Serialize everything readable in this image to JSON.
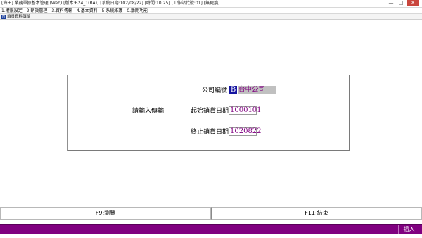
{
  "window": {
    "title": "[海田] 業務單據基本管理 (Web) [版本:B24_1(BA)] [系統日期:102/08/22] [時間:10:25] [工作站代號:01] [無更換]",
    "controls": {
      "minimize": "—",
      "maximize": "□",
      "close": "✕"
    }
  },
  "menu": {
    "items": [
      "1.權限設定",
      "2.銷貨管理",
      "3.資料傳輸",
      "4.基本資料",
      "5.系統維護",
      "0.離開功能"
    ]
  },
  "subwindow": {
    "icon": "app-icon",
    "title": "銷貨資料傳輸"
  },
  "form": {
    "prompt": "請輸入傳輸",
    "company_code_label": "公司編號",
    "company_code_value": "B",
    "company_name_value": "台中公司",
    "start_date_label": "起始銷貨日期",
    "start_date_value": "1000101",
    "end_date_label": "終止銷貨日期",
    "end_date_value": "1020822"
  },
  "function_keys": [
    {
      "label": "F9:瀏覽"
    },
    {
      "label": "F11:結束"
    }
  ],
  "statusbar": {
    "mode": "插入"
  },
  "colors": {
    "status_bar": "#800080",
    "value_text": "#800080",
    "code_highlight": "#1414a0",
    "name_field_bg": "#c0c0c0"
  }
}
